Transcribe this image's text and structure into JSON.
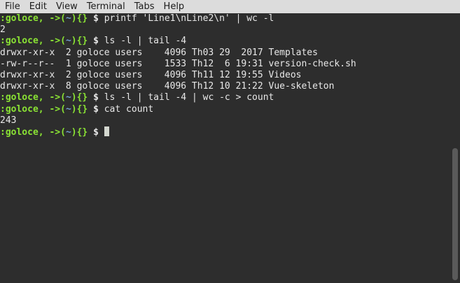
{
  "menu": [
    "File",
    "Edit",
    "View",
    "Terminal",
    "Tabs",
    "Help"
  ],
  "prompt": {
    "user": ":goloce,",
    "arrow": " ->",
    "open_paren": "(",
    "tilde": "~",
    "close_paren": ")",
    "braces": "{}",
    "dollar": " $ "
  },
  "lines": [
    {
      "type": "prompt",
      "cmd": "printf 'Line1\\nLine2\\n' | wc -l"
    },
    {
      "type": "out",
      "text": "2"
    },
    {
      "type": "prompt",
      "cmd": "ls -l | tail -4"
    },
    {
      "type": "out",
      "text": "drwxr-xr-x  2 goloce users    4096 Th03 29  2017 Templates"
    },
    {
      "type": "out",
      "text": "-rw-r--r--  1 goloce users    1533 Th12  6 19:31 version-check.sh"
    },
    {
      "type": "out",
      "text": "drwxr-xr-x  2 goloce users    4096 Th11 12 19:55 Videos"
    },
    {
      "type": "out",
      "text": "drwxr-xr-x  8 goloce users    4096 Th12 10 21:22 Vue-skeleton"
    },
    {
      "type": "prompt",
      "cmd": "ls -l | tail -4 | wc -c > count"
    },
    {
      "type": "prompt",
      "cmd": "cat count"
    },
    {
      "type": "out",
      "text": "243"
    },
    {
      "type": "prompt",
      "cmd": "",
      "cursor": true
    }
  ]
}
